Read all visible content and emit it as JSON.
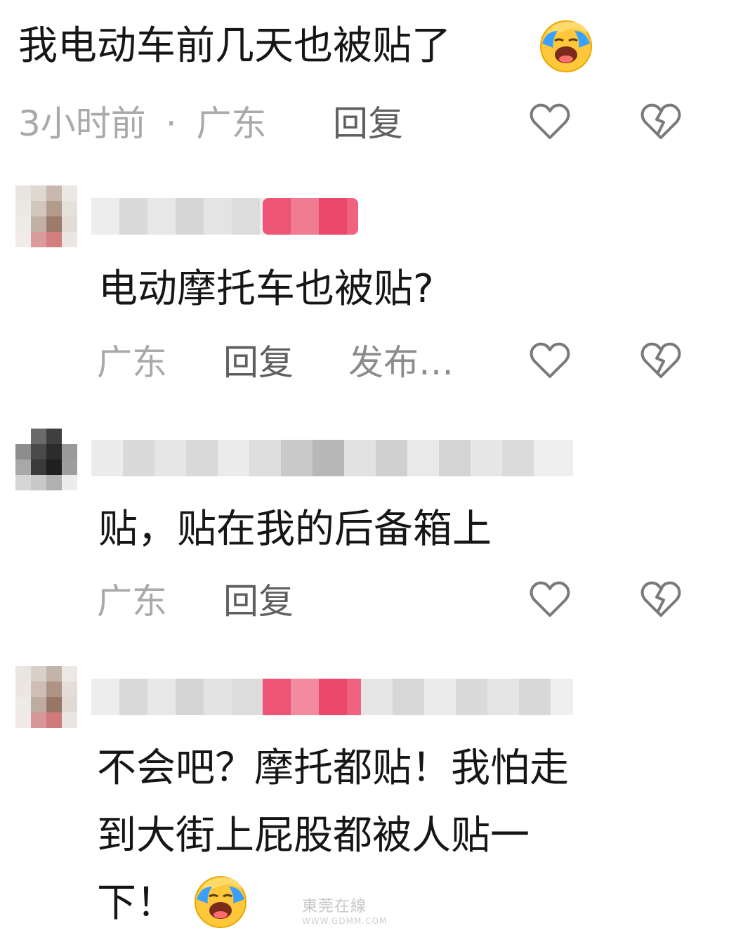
{
  "top_comment": {
    "text": "我电动车前几天也被贴了",
    "emoji": "laughing-crying-emoji",
    "meta_time": "3小时前",
    "meta_sep": "·",
    "meta_location": "广东",
    "reply_label": "回复"
  },
  "replies": [
    {
      "text": "电动摩托车也被贴?",
      "location": "广东",
      "reply_label": "回复",
      "publish_label": "发布…"
    },
    {
      "text": "贴，贴在我的后备箱上",
      "location": "广东",
      "reply_label": "回复"
    },
    {
      "text_line1": "不会吧？摩托都贴！我怕走",
      "text_line2": "到大街上屁股都被人贴一",
      "text_line3": "下！",
      "emoji": "laughing-crying-emoji"
    }
  ],
  "icons": {
    "like": "heart-outline-icon",
    "dislike": "broken-heart-icon"
  },
  "watermark": {
    "text": "東莞在線",
    "url": "WWW.GDMM.COM"
  },
  "colors": {
    "text": "#161616",
    "meta": "#a9a9a9",
    "reply": "#5f5f5f",
    "icon": "#7a7a7a",
    "tag_pink": "#ee4a6a"
  }
}
